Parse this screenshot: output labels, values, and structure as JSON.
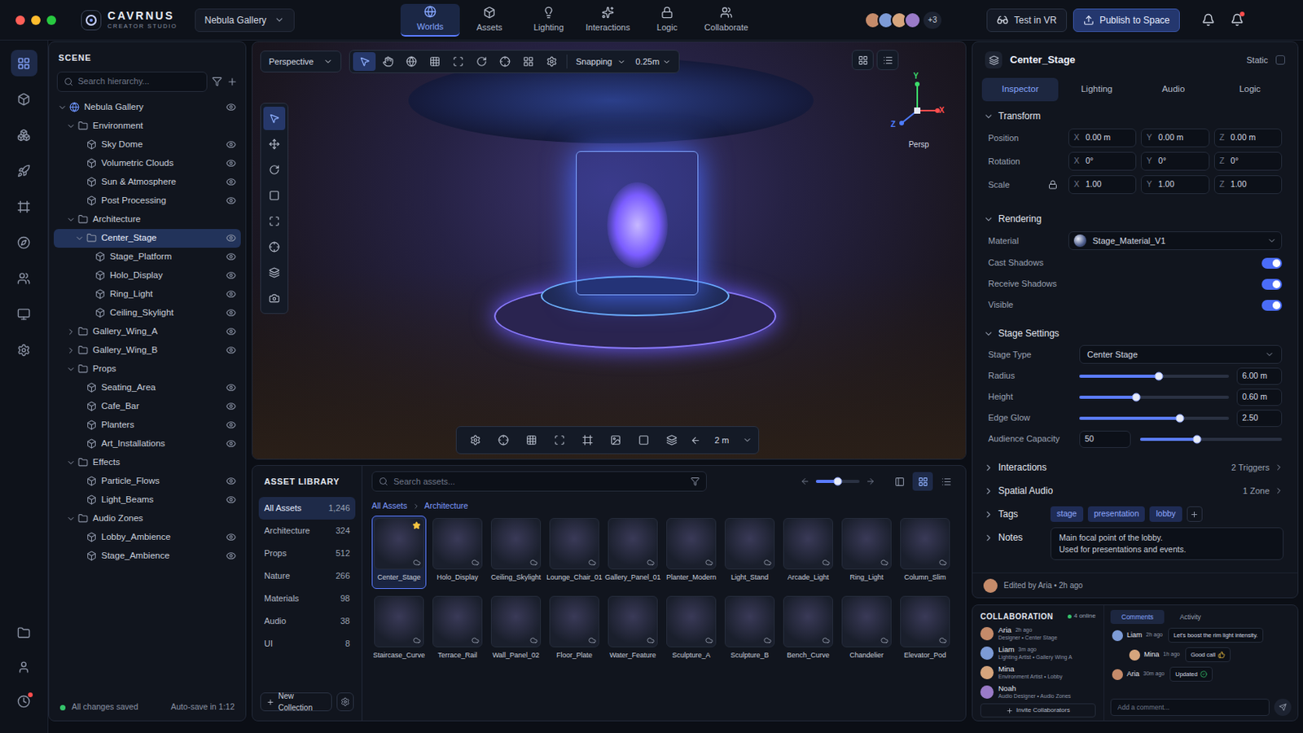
{
  "app": {
    "brand": "CAVRNUS",
    "subtitle": "CREATOR STUDIO",
    "project": "Nebula Gallery"
  },
  "window_controls": [
    {
      "color": "#ff5f57"
    },
    {
      "color": "#febc2e"
    },
    {
      "color": "#28c840"
    }
  ],
  "nav": [
    {
      "label": "Worlds",
      "selected": true
    },
    {
      "label": "Assets",
      "selected": false
    },
    {
      "label": "Lighting",
      "selected": false
    },
    {
      "label": "Interactions",
      "selected": false
    },
    {
      "label": "Logic",
      "selected": false
    },
    {
      "label": "Collaborate",
      "selected": false
    }
  ],
  "presence": {
    "avatars": [
      {
        "color": "#c58b6a"
      },
      {
        "color": "#7d9bd6"
      },
      {
        "color": "#d6a57d"
      },
      {
        "color": "#9a7bc8"
      }
    ],
    "extra": "+3"
  },
  "actions": {
    "test": "Test in VR",
    "publish": "Publish to Space"
  },
  "notifications": [
    {
      "badge": false
    },
    {
      "badge": true
    }
  ],
  "rail": {
    "top": [
      {
        "selected": true
      },
      {
        "selected": false
      },
      {
        "selected": false
      },
      {
        "selected": false
      },
      {
        "selected": false
      },
      {
        "selected": false
      },
      {
        "selected": false
      },
      {
        "selected": false
      },
      {
        "selected": false
      }
    ],
    "bottom": [
      {
        "badge": false
      },
      {
        "badge": false
      },
      {
        "badge": true
      }
    ]
  },
  "scene": {
    "title": "SCENE",
    "search_placeholder": "Search hierarchy...",
    "status": "All changes saved",
    "autosave": "Auto-save in 1:12",
    "tree": [
      {
        "label": "Nebula Gallery",
        "depth": 0,
        "has_children": true,
        "expanded": true,
        "selected": false,
        "eye": true
      },
      {
        "label": "Environment",
        "depth": 1,
        "has_children": true,
        "expanded": true,
        "selected": false,
        "eye": false
      },
      {
        "label": "Sky Dome",
        "depth": 2,
        "has_children": false,
        "expanded": false,
        "selected": false,
        "eye": true
      },
      {
        "label": "Volumetric Clouds",
        "depth": 2,
        "has_children": false,
        "expanded": false,
        "selected": false,
        "eye": true
      },
      {
        "label": "Sun & Atmosphere",
        "depth": 2,
        "has_children": false,
        "expanded": false,
        "selected": false,
        "eye": true
      },
      {
        "label": "Post Processing",
        "depth": 2,
        "has_children": false,
        "expanded": false,
        "selected": false,
        "eye": true
      },
      {
        "label": "Architecture",
        "depth": 1,
        "has_children": true,
        "expanded": true,
        "selected": false,
        "eye": false
      },
      {
        "label": "Center_Stage",
        "depth": 2,
        "has_children": true,
        "expanded": true,
        "selected": true,
        "eye": true
      },
      {
        "label": "Stage_Platform",
        "depth": 3,
        "has_children": false,
        "expanded": false,
        "selected": false,
        "eye": true
      },
      {
        "label": "Holo_Display",
        "depth": 3,
        "has_children": false,
        "expanded": false,
        "selected": false,
        "eye": true
      },
      {
        "label": "Ring_Light",
        "depth": 3,
        "has_children": false,
        "expanded": false,
        "selected": false,
        "eye": true
      },
      {
        "label": "Ceiling_Skylight",
        "depth": 3,
        "has_children": false,
        "expanded": false,
        "selected": false,
        "eye": true
      },
      {
        "label": "Gallery_Wing_A",
        "depth": 1,
        "has_children": true,
        "expanded": false,
        "selected": false,
        "eye": true
      },
      {
        "label": "Gallery_Wing_B",
        "depth": 1,
        "has_children": true,
        "expanded": false,
        "selected": false,
        "eye": true
      },
      {
        "label": "Props",
        "depth": 1,
        "has_children": true,
        "expanded": true,
        "selected": false,
        "eye": false
      },
      {
        "label": "Seating_Area",
        "depth": 2,
        "has_children": false,
        "expanded": false,
        "selected": false,
        "eye": true
      },
      {
        "label": "Cafe_Bar",
        "depth": 2,
        "has_children": false,
        "expanded": false,
        "selected": false,
        "eye": true
      },
      {
        "label": "Planters",
        "depth": 2,
        "has_children": false,
        "expanded": false,
        "selected": false,
        "eye": true
      },
      {
        "label": "Art_Installations",
        "depth": 2,
        "has_children": false,
        "expanded": false,
        "selected": false,
        "eye": true
      },
      {
        "label": "Effects",
        "depth": 1,
        "has_children": true,
        "expanded": true,
        "selected": false,
        "eye": false
      },
      {
        "label": "Particle_Flows",
        "depth": 2,
        "has_children": false,
        "expanded": false,
        "selected": false,
        "eye": true
      },
      {
        "label": "Light_Beams",
        "depth": 2,
        "has_children": false,
        "expanded": false,
        "selected": false,
        "eye": true
      },
      {
        "label": "Audio Zones",
        "depth": 1,
        "has_children": true,
        "expanded": true,
        "selected": false,
        "eye": false
      },
      {
        "label": "Lobby_Ambience",
        "depth": 2,
        "has_children": false,
        "expanded": false,
        "selected": false,
        "eye": true
      },
      {
        "label": "Stage_Ambience",
        "depth": 2,
        "has_children": false,
        "expanded": false,
        "selected": false,
        "eye": true
      }
    ]
  },
  "viewport": {
    "view": "Perspective",
    "snapping": "Snapping",
    "snap_value": "0.25m",
    "distance": "2 m",
    "top_tools": [
      {
        "selected": true
      },
      {
        "selected": false
      },
      {
        "selected": false
      },
      {
        "selected": false
      },
      {
        "selected": false
      },
      {
        "selected": false
      },
      {
        "selected": false
      },
      {
        "selected": false
      },
      {
        "selected": false
      }
    ],
    "side_tools": [
      {
        "selected": true
      },
      {
        "selected": false
      },
      {
        "selected": false
      },
      {
        "selected": false
      },
      {
        "selected": false
      },
      {
        "selected": false
      },
      {
        "selected": false
      },
      {
        "selected": false
      }
    ],
    "bottom_tools": [
      {
        "selected": false
      },
      {
        "selected": false
      },
      {
        "selected": false
      },
      {
        "selected": false
      },
      {
        "selected": false
      },
      {
        "selected": false
      },
      {
        "selected": false
      },
      {
        "selected": false
      }
    ],
    "gizmo": {
      "label": "Persp",
      "axes": [
        {
          "axis": "Y",
          "color": "#3ddc6b"
        },
        {
          "axis": "X",
          "color": "#ff4d4d"
        },
        {
          "axis": "Z",
          "color": "#4d7cff"
        }
      ]
    }
  },
  "assets": {
    "title": "ASSET LIBRARY",
    "new_collection": "New Collection",
    "search_placeholder": "Search assets...",
    "zoom": 0.5,
    "views": [
      {
        "selected": false
      },
      {
        "selected": true
      },
      {
        "selected": false
      }
    ],
    "breadcrumb": [
      "All Assets",
      "Architecture"
    ],
    "categories": [
      {
        "label": "All Assets",
        "count": "1,246",
        "selected": true
      },
      {
        "label": "Architecture",
        "count": "324",
        "selected": false
      },
      {
        "label": "Props",
        "count": "512",
        "selected": false
      },
      {
        "label": "Nature",
        "count": "266",
        "selected": false
      },
      {
        "label": "Materials",
        "count": "98",
        "selected": false
      },
      {
        "label": "Audio",
        "count": "38",
        "selected": false
      },
      {
        "label": "UI",
        "count": "8",
        "selected": false
      }
    ],
    "items": [
      {
        "name": "Center_Stage",
        "selected": true,
        "starred": true
      },
      {
        "name": "Holo_Display",
        "selected": false,
        "starred": false
      },
      {
        "name": "Ceiling_Skylight",
        "selected": false,
        "starred": false
      },
      {
        "name": "Lounge_Chair_01",
        "selected": false,
        "starred": false
      },
      {
        "name": "Gallery_Panel_01",
        "selected": false,
        "starred": false
      },
      {
        "name": "Planter_Modern",
        "selected": false,
        "starred": false
      },
      {
        "name": "Light_Stand",
        "selected": false,
        "starred": false
      },
      {
        "name": "Arcade_Light",
        "selected": false,
        "starred": false
      },
      {
        "name": "Ring_Light",
        "selected": false,
        "starred": false
      },
      {
        "name": "Column_Slim",
        "selected": false,
        "starred": false
      },
      {
        "name": "Staircase_Curve",
        "selected": false,
        "starred": false
      },
      {
        "name": "Terrace_Rail",
        "selected": false,
        "starred": false
      },
      {
        "name": "Wall_Panel_02",
        "selected": false,
        "starred": false
      },
      {
        "name": "Floor_Plate",
        "selected": false,
        "starred": false
      },
      {
        "name": "Water_Feature",
        "selected": false,
        "starred": false
      },
      {
        "name": "Sculpture_A",
        "selected": false,
        "starred": false
      },
      {
        "name": "Sculpture_B",
        "selected": false,
        "starred": false
      },
      {
        "name": "Bench_Curve",
        "selected": false,
        "starred": false
      },
      {
        "name": "Chandelier",
        "selected": false,
        "starred": false
      },
      {
        "name": "Elevator_Pod",
        "selected": false,
        "starred": false
      }
    ]
  },
  "inspector": {
    "object": "Center_Stage",
    "static": {
      "label": "Static",
      "checked": false
    },
    "tabs": [
      {
        "label": "Inspector",
        "selected": true
      },
      {
        "label": "Lighting",
        "selected": false
      },
      {
        "label": "Audio",
        "selected": false
      },
      {
        "label": "Logic",
        "selected": false
      }
    ],
    "transform": {
      "title": "Transform",
      "expanded": true,
      "scale_locked": true,
      "rows": [
        {
          "label": "Position",
          "values": [
            {
              "axis": "X",
              "value": "0.00 m"
            },
            {
              "axis": "Y",
              "value": "0.00 m"
            },
            {
              "axis": "Z",
              "value": "0.00 m"
            }
          ]
        },
        {
          "label": "Rotation",
          "values": [
            {
              "axis": "X",
              "value": "0°"
            },
            {
              "axis": "Y",
              "value": "0°"
            },
            {
              "axis": "Z",
              "value": "0°"
            }
          ]
        },
        {
          "label": "Scale",
          "values": [
            {
              "axis": "X",
              "value": "1.00"
            },
            {
              "axis": "Y",
              "value": "1.00"
            },
            {
              "axis": "Z",
              "value": "1.00"
            }
          ]
        }
      ]
    },
    "rendering": {
      "title": "Rendering",
      "expanded": true,
      "material_label": "Material",
      "material": "Stage_Material_V1",
      "toggles": [
        {
          "label": "Cast Shadows",
          "on": true
        },
        {
          "label": "Receive Shadows",
          "on": true
        },
        {
          "label": "Visible",
          "on": true
        }
      ]
    },
    "stage": {
      "title": "Stage Settings",
      "expanded": true,
      "type_label": "Stage Type",
      "type": "Center Stage",
      "sliders": [
        {
          "label": "Radius",
          "level": 0.53,
          "reading": "6.00 m"
        },
        {
          "label": "Height",
          "level": 0.38,
          "reading": "0.60 m"
        },
        {
          "label": "Edge Glow",
          "level": 0.67,
          "reading": "2.50"
        }
      ],
      "capacity": {
        "label": "Audience Capacity",
        "value": "50",
        "level": 0.4
      }
    },
    "groups": [
      {
        "title": "Interactions",
        "expanded": false,
        "summary": "2 Triggers"
      },
      {
        "title": "Spatial Audio",
        "expanded": false,
        "summary": "1 Zone"
      }
    ],
    "tags": {
      "title": "Tags",
      "expanded": false,
      "items": [
        "stage",
        "presentation",
        "lobby"
      ]
    },
    "notes": {
      "title": "Notes",
      "expanded": false,
      "lines": [
        "Main focal point of the lobby.",
        "Used for presentations and events."
      ]
    },
    "edited": "Edited by Aria • 2h ago"
  },
  "collaboration": {
    "title": "COLLABORATION",
    "online": "4 online",
    "invite": "Invite Collaborators",
    "placeholder": "Add a comment...",
    "users": [
      {
        "name": "Aria",
        "time": "2h ago",
        "role": "Designer • Center Stage",
        "color": "#c58b6a"
      },
      {
        "name": "Liam",
        "time": "3m ago",
        "role": "Lighting Artist • Gallery Wing A",
        "color": "#7d9bd6"
      },
      {
        "name": "Mina",
        "time": "",
        "role": "Environment Artist • Lobby",
        "color": "#d6a57d"
      },
      {
        "name": "Noah",
        "time": "",
        "role": "Audio Designer • Audio Zones",
        "color": "#9a7bc8"
      }
    ],
    "tabs": [
      {
        "label": "Comments",
        "selected": true
      },
      {
        "label": "Activity",
        "selected": false
      }
    ],
    "comments": [
      {
        "name": "Liam",
        "time": "2h ago",
        "text": "Let's boost the rim light intensity.",
        "kind": "plain",
        "reply": false,
        "color": "#7d9bd6"
      },
      {
        "name": "Mina",
        "time": "1h ago",
        "text": "Good call",
        "kind": "thumbs",
        "reply": true,
        "color": "#d6a57d"
      },
      {
        "name": "Aria",
        "time": "30m ago",
        "text": "Updated",
        "kind": "check",
        "reply": false,
        "color": "#c58b6a"
      }
    ]
  }
}
